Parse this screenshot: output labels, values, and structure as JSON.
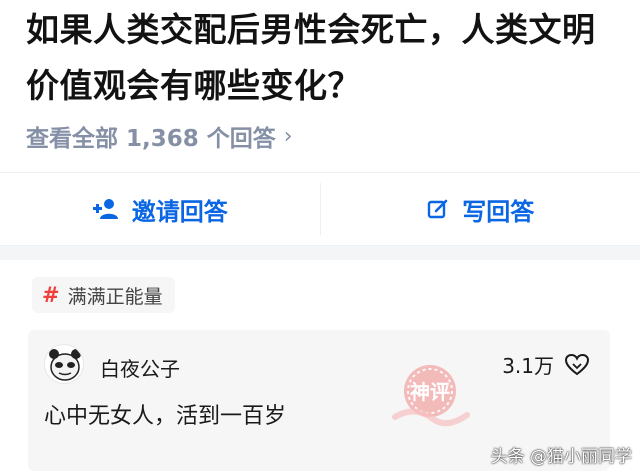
{
  "question": {
    "title": "如果人类交配后男性会死亡，人类文明价值观会有哪些变化？",
    "view_all": "查看全部 1,368 个回答",
    "chevron": "›"
  },
  "actions": {
    "invite_label": "邀请回答",
    "invite_icon": "add-user-icon",
    "write_label": "写回答",
    "write_icon": "edit-icon"
  },
  "topic": {
    "hash": "#",
    "label": "满满正能量"
  },
  "answer": {
    "author": "白夜公子",
    "likes": "3.1万",
    "text": "心中无女人，活到一百岁"
  },
  "stamp": {
    "text": "神评"
  },
  "watermark": {
    "text": "头条 @猫小丽同学"
  },
  "colors": {
    "accent_blue": "#0b66e4",
    "meta_gray": "#8590a6",
    "tag_red": "#f1403c",
    "stamp_red": "#f2a5a5"
  }
}
